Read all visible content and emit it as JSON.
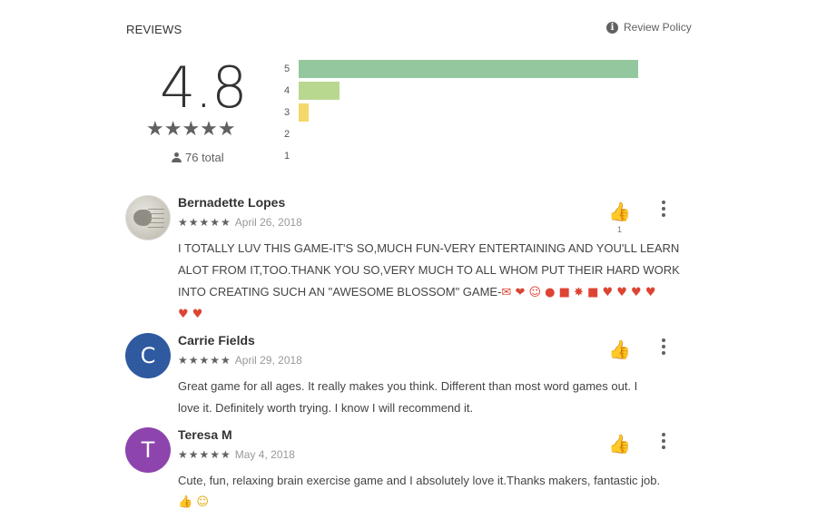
{
  "header": {
    "title": "REVIEWS",
    "policy_label": "Review Policy"
  },
  "summary": {
    "score": "4.8",
    "total": "76 total",
    "stars": "★★★★★"
  },
  "histogram": [
    {
      "label": "5",
      "fraction": 0.83,
      "color": "#93c79d"
    },
    {
      "label": "4",
      "fraction": 0.1,
      "color": "#b9d88f"
    },
    {
      "label": "3",
      "fraction": 0.025,
      "color": "#f2d969"
    },
    {
      "label": "2",
      "fraction": 0,
      "color": "#f8b877"
    },
    {
      "label": "1",
      "fraction": 0,
      "color": "#f3917c"
    }
  ],
  "reviews": [
    {
      "name": "Bernadette Lopes",
      "date": "April 26, 2018",
      "stars": "★★★★★",
      "line1": "I TOTALLY LUV THIS GAME-IT'S SO,MUCH FUN-VERY ENTERTAINING AND YOU'LL LEARN",
      "line2": "ALOT FROM IT,TOO.THANK YOU SO,VERY MUCH TO ALL WHOM PUT THEIR HARD WORK",
      "line3": "INTO CREATING SUCH AN \"AWESOME BLOSSOM\" GAME-",
      "line3_emoji": "✉ ❤ ☺ ● ■ ✸ ■ ♥ ♥ ♥ ♥",
      "line4_emoji": "♥ ♥",
      "likes": "1"
    },
    {
      "name": "Carrie Fields",
      "initial": "C",
      "date": "April 29, 2018",
      "stars": "★★★★★",
      "line1": "Great game for all ages. It really makes you think. Different than most word games out. I",
      "line2": "love it. Definitely worth trying. I know I will recommend it."
    },
    {
      "name": "Teresa M",
      "initial": "T",
      "date": "May 4, 2018",
      "stars": "★★★★★",
      "line1": "Cute, fun, relaxing brain exercise game and I absolutely love it.Thanks makers, fantastic job.",
      "line2_emoji": "👍 ☺"
    }
  ],
  "colors": {
    "avatar_c": "#2f5aa0",
    "avatar_t": "#8e44ad"
  },
  "icons": {
    "thumb": "thumbs-up-icon",
    "more": "more-vert-icon",
    "info": "info-icon",
    "person": "person-icon"
  }
}
